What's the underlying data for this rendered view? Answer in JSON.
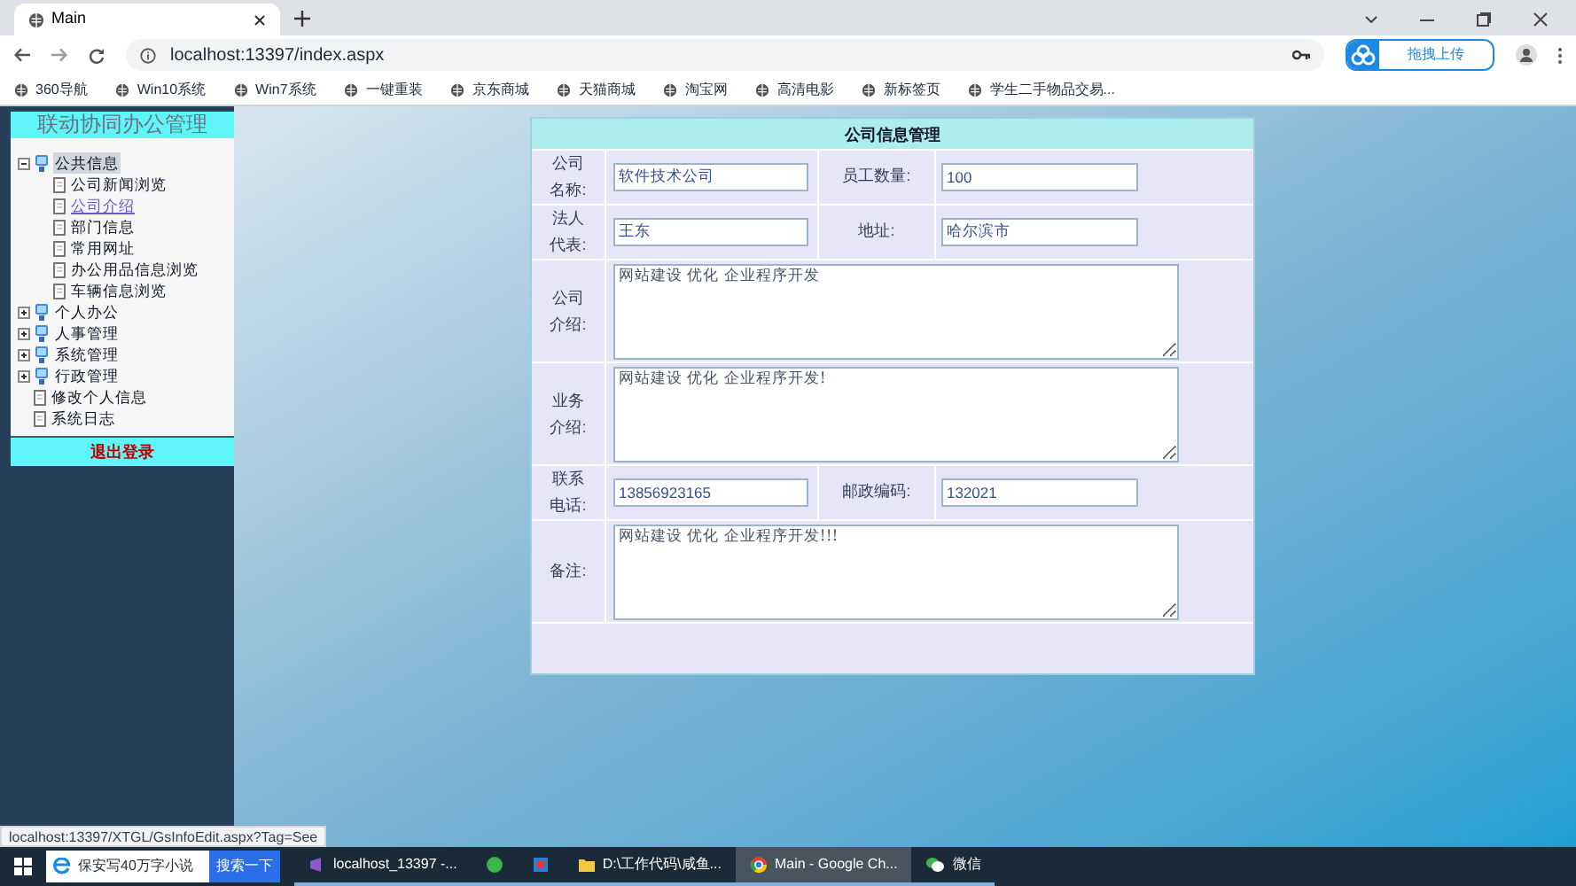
{
  "browser": {
    "tab_title": "Main",
    "url": "localhost:13397/index.aspx",
    "extension_label": "拖拽上传",
    "bookmarks": [
      "360导航",
      "Win10系统",
      "Win7系统",
      "一键重装",
      "京东商城",
      "天猫商城",
      "淘宝网",
      "高清电影",
      "新标签页",
      "学生二手物品交易..."
    ]
  },
  "sidebar": {
    "title": "联动协同办公管理",
    "tree": [
      {
        "label": "公共信息",
        "expanded": true,
        "selected": true,
        "children": [
          {
            "label": "公司新闻浏览",
            "visited": false
          },
          {
            "label": "公司介绍",
            "visited": true
          },
          {
            "label": "部门信息",
            "visited": false
          },
          {
            "label": "常用网址",
            "visited": false
          },
          {
            "label": "办公用品信息浏览",
            "visited": false
          },
          {
            "label": "车辆信息浏览",
            "visited": false
          }
        ]
      },
      {
        "label": "个人办公",
        "expanded": false,
        "selected": false
      },
      {
        "label": "人事管理",
        "expanded": false,
        "selected": false
      },
      {
        "label": "系统管理",
        "expanded": false,
        "selected": false
      },
      {
        "label": "行政管理",
        "expanded": false,
        "selected": false
      }
    ],
    "links": [
      "修改个人信息",
      "系统日志"
    ],
    "logout": "退出登录"
  },
  "form": {
    "title": "公司信息管理",
    "rows": [
      {
        "kind": "pair",
        "label": "公司名称:",
        "value": "软件技术公司",
        "label2": "员工数量:",
        "value2": "100"
      },
      {
        "kind": "pair",
        "label": "法人代表:",
        "value": "王东",
        "label2": "地址:",
        "value2": "哈尔滨市"
      },
      {
        "kind": "textarea",
        "label": "公司介绍:",
        "value": "网站建设 优化 企业程序开发"
      },
      {
        "kind": "textarea",
        "label": "业务介绍:",
        "value": "网站建设 优化 企业程序开发!"
      },
      {
        "kind": "pair",
        "label": "联系电话:",
        "value": "13856923165",
        "label2": "邮政编码:",
        "value2": "132021"
      },
      {
        "kind": "textarea",
        "label": "备注:",
        "value": "网站建设 优化 企业程序开发!!!"
      }
    ]
  },
  "status_url": "localhost:13397/XTGL/GsInfoEdit.aspx?Tag=See",
  "taskbar": {
    "search_placeholder": "保安写40万字小说",
    "search_button": "搜索一下",
    "apps": [
      {
        "label": "localhost_13397 -...",
        "active": false
      },
      {
        "active": false
      },
      {
        "active": false
      },
      {
        "label": "D:\\工作代码\\咸鱼...",
        "active": false
      },
      {
        "label": "Main - Google Ch...",
        "active": true
      },
      {
        "label": "微信",
        "active": false
      }
    ]
  }
}
